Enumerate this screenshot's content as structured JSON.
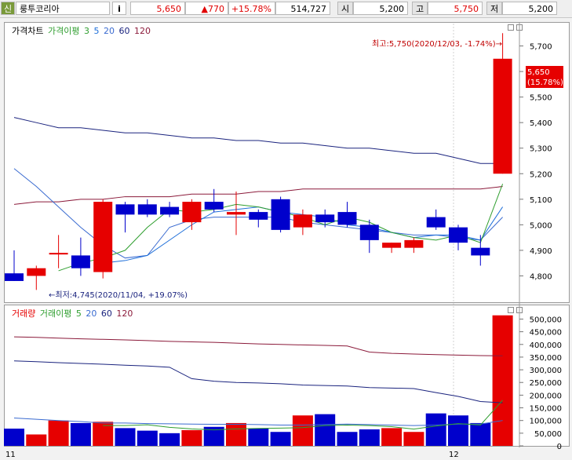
{
  "header": {
    "badge": "신",
    "stock_name": "룽투코리아",
    "info_button": "i",
    "price": "5,650",
    "change": "▲770",
    "change_pct": "+15.78%",
    "volume": "514,727",
    "open_label": "시",
    "open": "5,200",
    "high_label": "고",
    "high": "5,750",
    "low_label": "저",
    "low": "5,200"
  },
  "price_pane": {
    "legend": {
      "chart": "가격차트",
      "ma": "가격이평",
      "p3": "3",
      "p5": "5",
      "p20": "20",
      "p60": "60",
      "p120": "120"
    },
    "high_note": "최고:5,750(2020/12/03, -1.74%)→",
    "low_note": "←최저:4,745(2020/11/04, +19.07%)",
    "current_price": "5,650",
    "current_pct": "(15.78%)",
    "y_ticks": [
      "5,700",
      "5,600",
      "5,500",
      "5,400",
      "5,300",
      "5,200",
      "5,100",
      "5,000",
      "4,900",
      "4,800"
    ]
  },
  "volume_pane": {
    "legend": {
      "chart": "거래량",
      "ma": "거래이평",
      "p5": "5",
      "p20": "20",
      "p60": "60",
      "p120": "120"
    },
    "y_ticks": [
      "500,000",
      "450,000",
      "400,000",
      "350,000",
      "300,000",
      "250,000",
      "200,000",
      "150,000",
      "100,000",
      "50,000",
      "0"
    ]
  },
  "x_labels": [
    "11",
    "12"
  ],
  "colors": {
    "up": "#e60000",
    "down": "#0000cc",
    "ma3": "#2f9e2f",
    "ma5": "#1e6fd9",
    "ma20": "#3a6bd0",
    "ma60": "#1a237e",
    "ma120": "#8b1a3a"
  },
  "chart_data": {
    "type": "candlestick",
    "y_range": [
      4700,
      5800
    ],
    "volume_range": [
      0,
      520000
    ],
    "candles": [
      {
        "o": 4810,
        "h": 4900,
        "l": 4780,
        "c": 4780,
        "v": 68000
      },
      {
        "o": 4800,
        "h": 4840,
        "l": 4745,
        "c": 4830,
        "v": 45000
      },
      {
        "o": 4890,
        "h": 4960,
        "l": 4830,
        "c": 4890,
        "v": 100000
      },
      {
        "o": 4880,
        "h": 4950,
        "l": 4800,
        "c": 4830,
        "v": 90000
      },
      {
        "o": 4815,
        "h": 5100,
        "l": 4790,
        "c": 5090,
        "v": 95000
      },
      {
        "o": 5080,
        "h": 5090,
        "l": 4970,
        "c": 5040,
        "v": 70000
      },
      {
        "o": 5080,
        "h": 5100,
        "l": 5030,
        "c": 5040,
        "v": 60000
      },
      {
        "o": 5070,
        "h": 5090,
        "l": 5030,
        "c": 5040,
        "v": 50000
      },
      {
        "o": 5010,
        "h": 5100,
        "l": 4980,
        "c": 5090,
        "v": 62000
      },
      {
        "o": 5090,
        "h": 5140,
        "l": 5050,
        "c": 5060,
        "v": 75000
      },
      {
        "o": 5040,
        "h": 5130,
        "l": 4960,
        "c": 5050,
        "v": 90000
      },
      {
        "o": 5050,
        "h": 5060,
        "l": 4990,
        "c": 5020,
        "v": 68000
      },
      {
        "o": 5100,
        "h": 5110,
        "l": 4970,
        "c": 4980,
        "v": 55000
      },
      {
        "o": 4990,
        "h": 5060,
        "l": 4960,
        "c": 5040,
        "v": 120000
      },
      {
        "o": 5040,
        "h": 5060,
        "l": 4990,
        "c": 5010,
        "v": 125000
      },
      {
        "o": 5050,
        "h": 5090,
        "l": 4990,
        "c": 5000,
        "v": 55000
      },
      {
        "o": 5000,
        "h": 5020,
        "l": 4890,
        "c": 4940,
        "v": 65000
      },
      {
        "o": 4910,
        "h": 4930,
        "l": 4890,
        "c": 4930,
        "v": 70000
      },
      {
        "o": 4910,
        "h": 4950,
        "l": 4890,
        "c": 4940,
        "v": 55000
      },
      {
        "o": 5030,
        "h": 5060,
        "l": 4980,
        "c": 4990,
        "v": 128000
      },
      {
        "o": 4990,
        "h": 5000,
        "l": 4900,
        "c": 4930,
        "v": 120000
      },
      {
        "o": 4910,
        "h": 4960,
        "l": 4840,
        "c": 4880,
        "v": 90000
      },
      {
        "o": 5200,
        "h": 5750,
        "l": 5200,
        "c": 5650,
        "v": 514727
      }
    ],
    "ma3": [
      null,
      null,
      4820,
      4850,
      4870,
      4900,
      4990,
      5060,
      5050,
      5060,
      5080,
      5070,
      5050,
      5030,
      5000,
      5030,
      5010,
      4970,
      4950,
      4940,
      4960,
      4930,
      5160
    ],
    "ma5": [
      null,
      null,
      null,
      null,
      4850,
      4860,
      4880,
      4940,
      5000,
      5050,
      5060,
      5070,
      5050,
      5040,
      5030,
      5000,
      4990,
      4970,
      4950,
      4960,
      4960,
      4940,
      5070
    ],
    "ma20": [
      5220,
      5150,
      5070,
      4990,
      4920,
      4870,
      4880,
      4990,
      5020,
      5030,
      5030,
      5030,
      5030,
      5010,
      5000,
      4990,
      4980,
      4970,
      4960,
      4960,
      4950,
      4940,
      5030
    ],
    "ma60": [
      5420,
      5400,
      5380,
      5380,
      5370,
      5360,
      5360,
      5350,
      5340,
      5340,
      5330,
      5330,
      5320,
      5320,
      5310,
      5300,
      5300,
      5290,
      5280,
      5280,
      5260,
      5240,
      5240
    ],
    "ma120": [
      5080,
      5090,
      5090,
      5100,
      5100,
      5110,
      5110,
      5110,
      5120,
      5120,
      5120,
      5130,
      5130,
      5140,
      5140,
      5140,
      5140,
      5140,
      5140,
      5140,
      5140,
      5140,
      5150
    ],
    "vma5": [
      null,
      null,
      null,
      null,
      80000,
      80000,
      83000,
      73000,
      67000,
      63000,
      67000,
      69000,
      70000,
      72000,
      80000,
      82000,
      80000,
      76000,
      66000,
      78000,
      88000,
      82000,
      180000
    ],
    "vma20": [
      110000,
      105000,
      100000,
      96000,
      90000,
      90000,
      88000,
      87000,
      86000,
      85000,
      85000,
      84000,
      82000,
      82000,
      84000,
      86000,
      84000,
      82000,
      80000,
      82000,
      86000,
      86000,
      100000
    ],
    "vma60": [
      335000,
      332000,
      328000,
      325000,
      322000,
      318000,
      315000,
      310000,
      265000,
      255000,
      250000,
      248000,
      245000,
      240000,
      238000,
      236000,
      230000,
      228000,
      226000,
      210000,
      195000,
      175000,
      170000
    ],
    "vma120": [
      430000,
      428000,
      425000,
      422000,
      420000,
      418000,
      415000,
      412000,
      410000,
      408000,
      405000,
      402000,
      400000,
      398000,
      396000,
      394000,
      370000,
      365000,
      362000,
      360000,
      358000,
      356000,
      355000
    ]
  }
}
